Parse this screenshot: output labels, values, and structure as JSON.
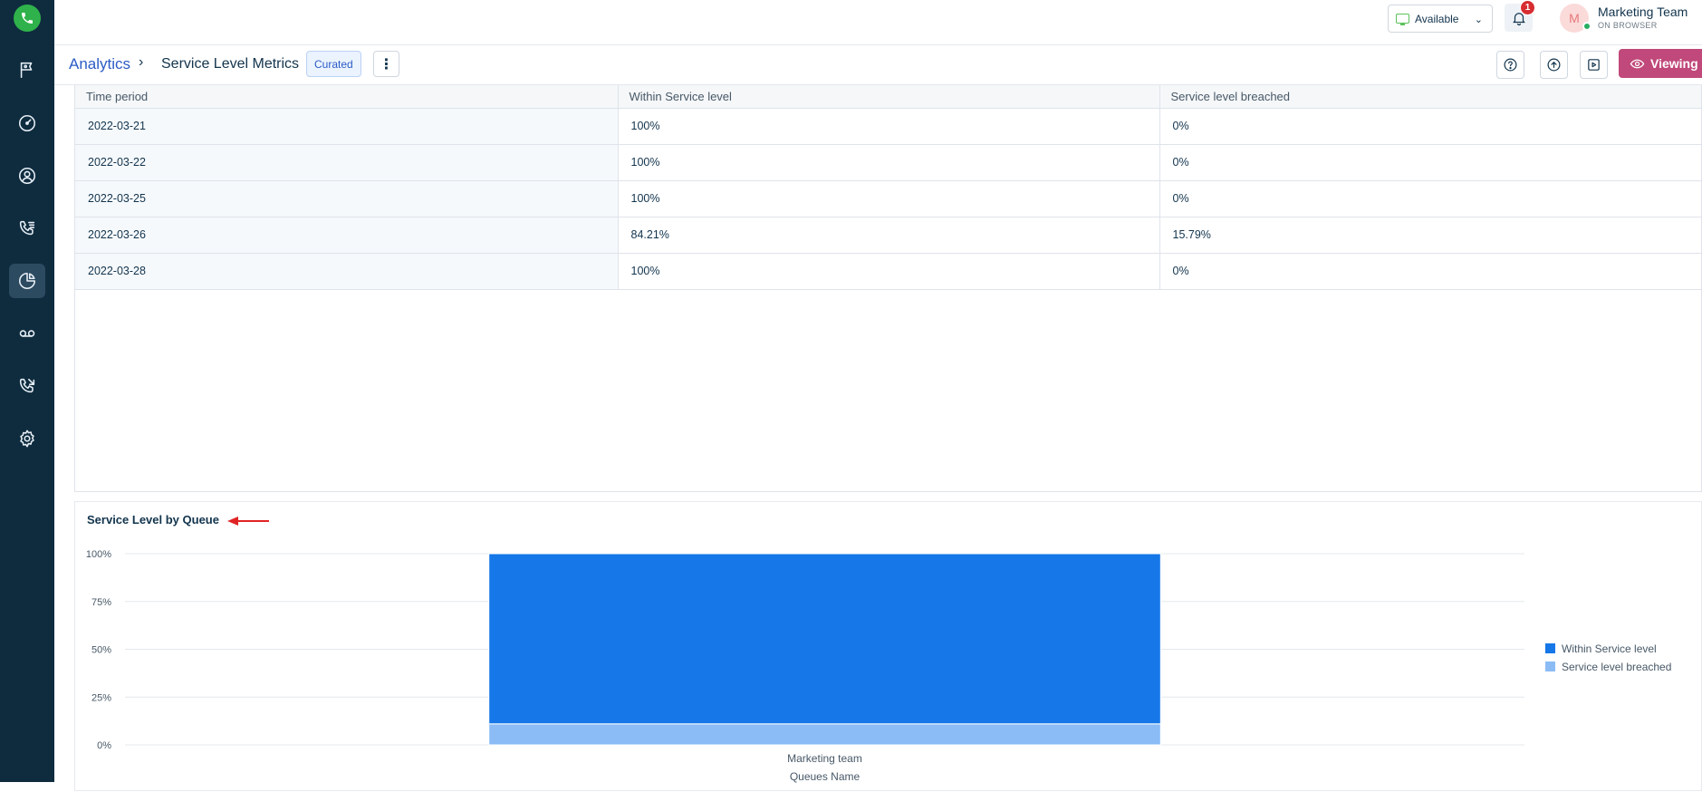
{
  "header": {
    "status": "Available",
    "notification_count": "1",
    "user": {
      "initial": "M",
      "name": "Marketing Team",
      "sub": "ON BROWSER"
    }
  },
  "subheader": {
    "breadcrumb": "Analytics",
    "separator": "›",
    "title": "Service Level Metrics",
    "tag": "Curated",
    "viewing_label": "Viewing"
  },
  "table": {
    "columns": [
      "Time period",
      "Within Service level",
      "Service level breached"
    ],
    "rows": [
      [
        "2022-03-21",
        "100%",
        "0%"
      ],
      [
        "2022-03-22",
        "100%",
        "0%"
      ],
      [
        "2022-03-25",
        "100%",
        "0%"
      ],
      [
        "2022-03-26",
        "84.21%",
        "15.79%"
      ],
      [
        "2022-03-28",
        "100%",
        "0%"
      ]
    ]
  },
  "colors": {
    "within": "#1677e8",
    "breached": "#8bbcf6",
    "accent": "#c0487a",
    "sidebar": "#0f2c3f"
  },
  "chart_data": {
    "type": "bar",
    "stacked": true,
    "title": "Service Level by Queue",
    "xlabel": "Queues Name",
    "ylabel": "",
    "categories": [
      "Marketing team"
    ],
    "series": [
      {
        "name": "Within Service level",
        "values": [
          89
        ]
      },
      {
        "name": "Service level breached",
        "values": [
          11
        ]
      }
    ],
    "y_ticks": [
      "0%",
      "25%",
      "50%",
      "75%",
      "100%"
    ],
    "ylim": [
      0,
      100
    ],
    "legend": "right",
    "grid": true
  }
}
